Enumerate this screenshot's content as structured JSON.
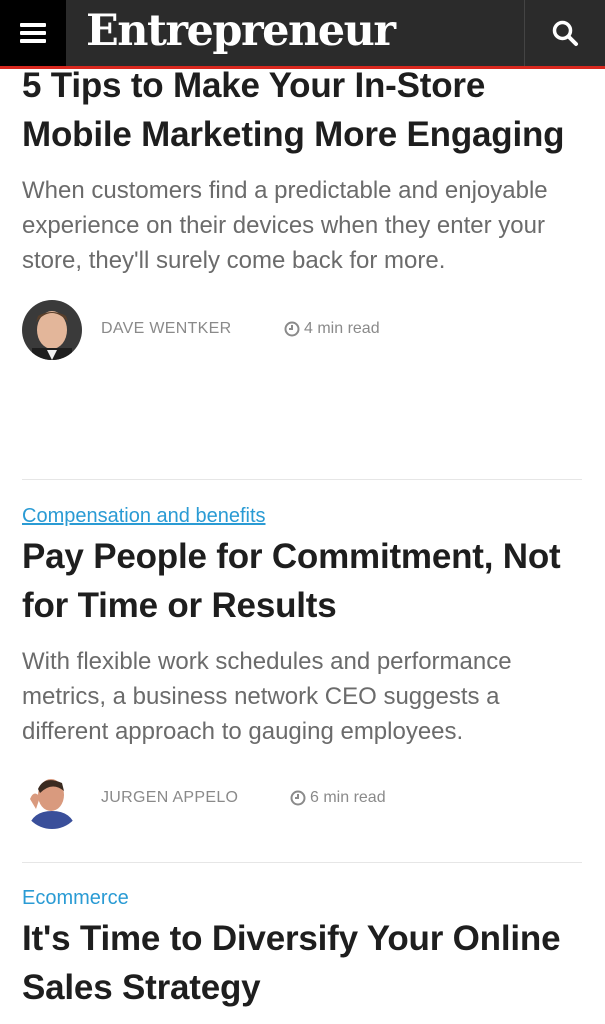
{
  "header": {
    "logo": "Entrepreneur",
    "menu_icon": "hamburger-menu-icon",
    "search_icon": "search-icon",
    "background": "#2b2b2b",
    "accent": "#d9281f"
  },
  "articles": [
    {
      "category": "",
      "headline": "5 Tips to Make Your In-Store Mobile Marketing More Engaging",
      "dek": "When customers find a predictable and enjoyable experience on their devices when they enter your store, they'll surely come back for more.",
      "author": "DAVE WENTKER",
      "read_time": "4 min read"
    },
    {
      "category": "Compensation and benefits",
      "headline": "Pay People for Commitment, Not for Time or Results",
      "dek": "With flexible work schedules and performance metrics, a business network CEO suggests a different approach to gauging employees.",
      "author": "JURGEN APPELO",
      "read_time": "6 min read"
    },
    {
      "category": "Ecommerce",
      "headline": "It's Time to Diversify Your Online Sales Strategy"
    }
  ],
  "colors": {
    "category_link": "#2a9bd4",
    "meta_text": "#8a8a8a",
    "dek_text": "#6b6b6b"
  }
}
